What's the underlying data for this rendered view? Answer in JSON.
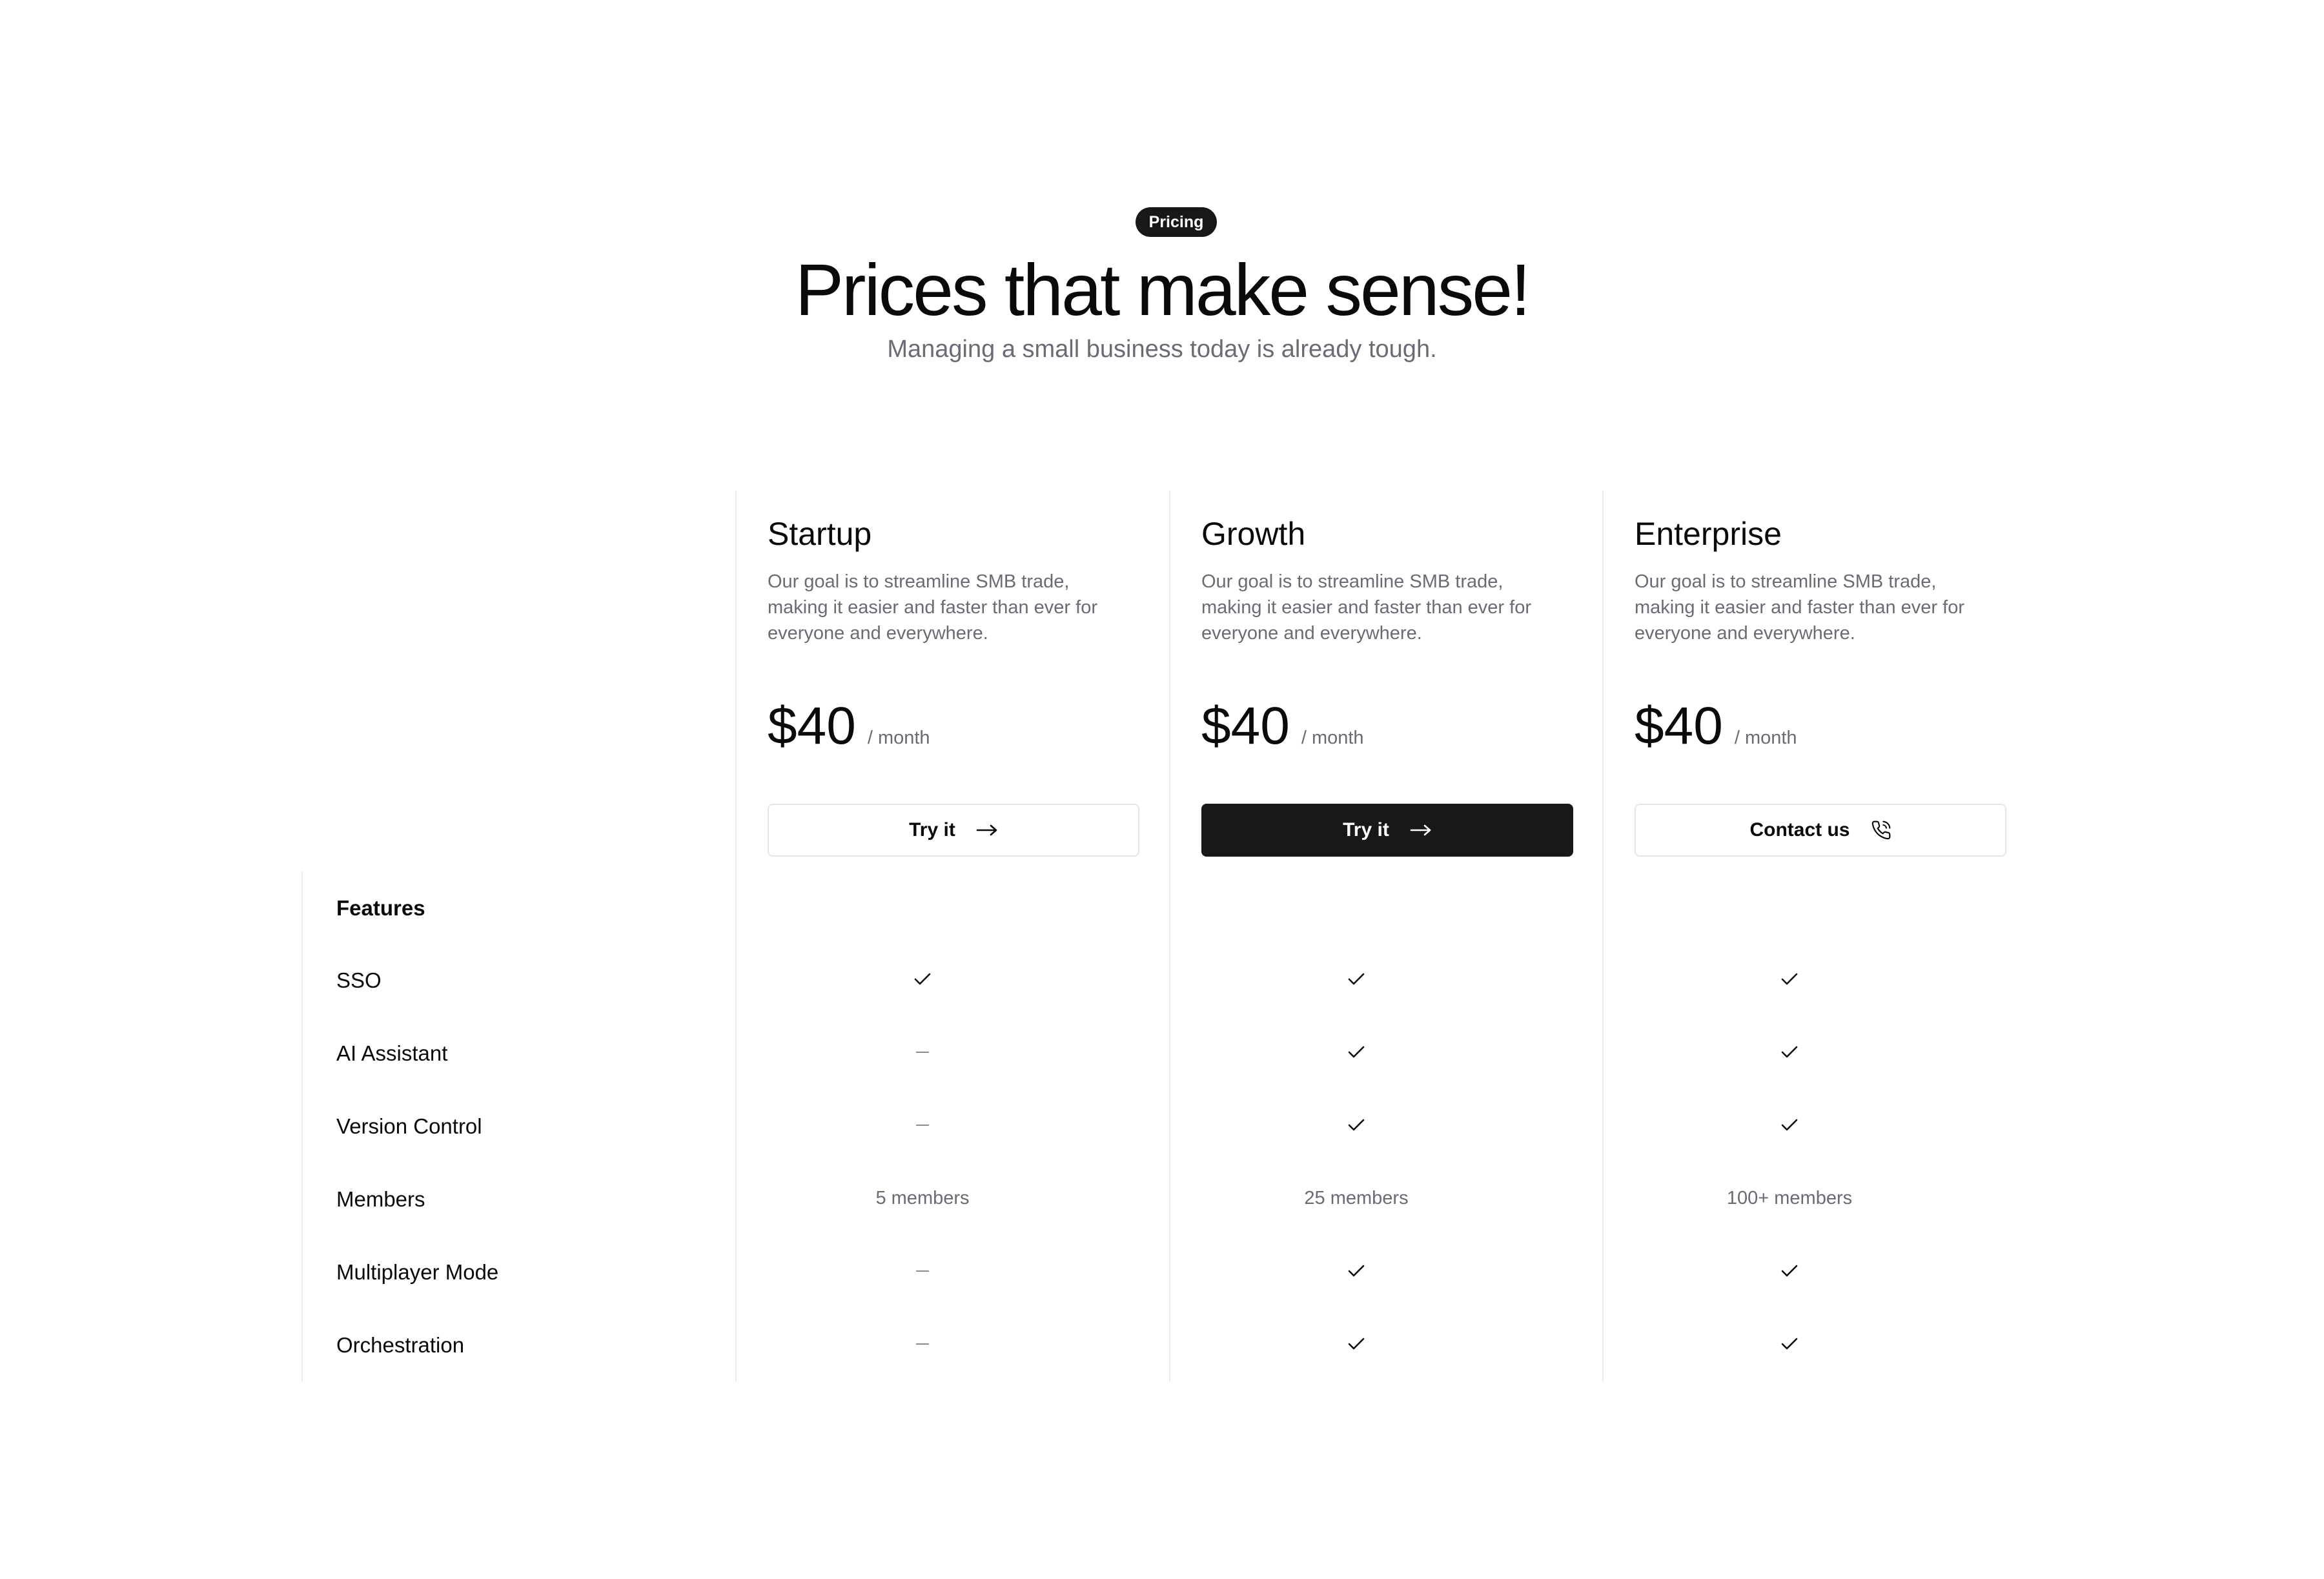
{
  "header": {
    "badge": "Pricing",
    "title": "Prices that make sense!",
    "subtitle": "Managing a small business today is already tough."
  },
  "plans": [
    {
      "name": "Startup",
      "description": "Our goal is to streamline SMB trade, making it easier and faster than ever for everyone and everywhere.",
      "price": "$40",
      "period": "/ month",
      "cta": "Try it",
      "cta_icon": "arrow-right-icon",
      "cta_style": "outline"
    },
    {
      "name": "Growth",
      "description": "Our goal is to streamline SMB trade, making it easier and faster than ever for everyone and everywhere.",
      "price": "$40",
      "period": "/ month",
      "cta": "Try it",
      "cta_icon": "arrow-right-icon",
      "cta_style": "filled"
    },
    {
      "name": "Enterprise",
      "description": "Our goal is to streamline SMB trade, making it easier and faster than ever for everyone and everywhere.",
      "price": "$40",
      "period": "/ month",
      "cta": "Contact us",
      "cta_icon": "phone-icon",
      "cta_style": "outline"
    }
  ],
  "features": {
    "heading": "Features",
    "rows": [
      {
        "label": "SSO",
        "values": [
          "check",
          "check",
          "check"
        ]
      },
      {
        "label": "AI Assistant",
        "values": [
          "dash",
          "check",
          "check"
        ]
      },
      {
        "label": "Version Control",
        "values": [
          "dash",
          "check",
          "check"
        ]
      },
      {
        "label": "Members",
        "values": [
          "5 members",
          "25 members",
          "100+ members"
        ]
      },
      {
        "label": "Multiplayer Mode",
        "values": [
          "dash",
          "check",
          "check"
        ]
      },
      {
        "label": "Orchestration",
        "values": [
          "dash",
          "check",
          "check"
        ]
      }
    ]
  },
  "colors": {
    "dark": "#18181b",
    "muted_text": "#6b6b73",
    "divider": "#ececee"
  }
}
